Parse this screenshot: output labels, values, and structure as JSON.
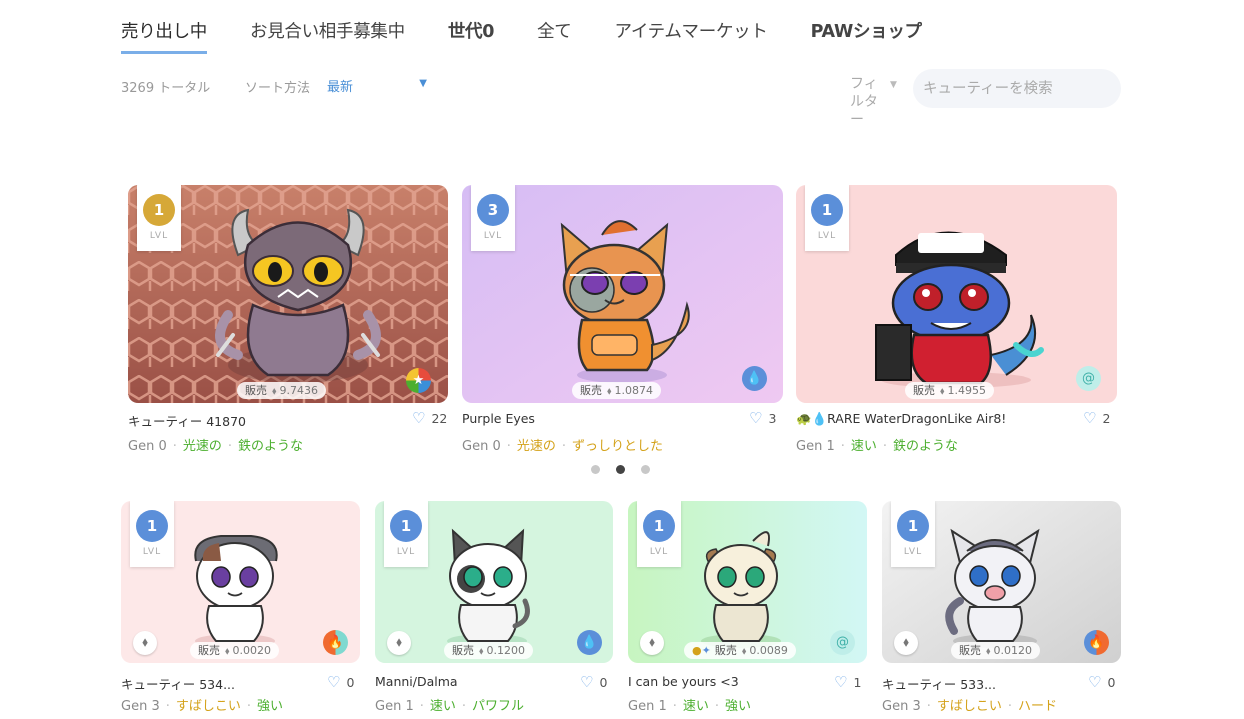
{
  "tabs": [
    {
      "label": "売り出し中",
      "active": true
    },
    {
      "label": "お見合い相手募集中"
    },
    {
      "label": "世代0"
    },
    {
      "label": "全て"
    },
    {
      "label": "アイテムマーケット"
    },
    {
      "label": "PAWショップ"
    }
  ],
  "toolbar": {
    "total": "3269 トータル",
    "sort_label": "ソート方法",
    "sort_value": "最新",
    "filter_label": "フィルター",
    "search_placeholder": "キューティーを検索"
  },
  "featured": [
    {
      "level": "1",
      "level_color": "gold",
      "lvl_label": "LVL",
      "sale": "販売",
      "price": "9.7436",
      "name": "キューティー 41870",
      "likes": "22",
      "gen": "Gen 0",
      "traits": [
        "光速の",
        "鉄のような"
      ],
      "trait_colors": [
        "green",
        "green"
      ],
      "element": "multi"
    },
    {
      "level": "3",
      "level_color": "blue",
      "lvl_label": "LVL",
      "sale": "販売",
      "price": "1.0874",
      "name": "Purple Eyes",
      "likes": "3",
      "gen": "Gen 0",
      "traits": [
        "光速の",
        "ずっしりとした"
      ],
      "trait_colors": [
        "gold",
        "gold"
      ],
      "element": "water"
    },
    {
      "level": "1",
      "level_color": "blue",
      "lvl_label": "LVL",
      "sale": "販売",
      "price": "1.4955",
      "name": "🐢💧RARE WaterDragonLike Air8!",
      "likes": "2",
      "gen": "Gen 1",
      "traits": [
        "速い",
        "鉄のような"
      ],
      "trait_colors": [
        "green",
        "green"
      ],
      "element": "air"
    }
  ],
  "carousel": {
    "pages": 3,
    "active": 1
  },
  "listing": [
    {
      "level": "1",
      "lvl_label": "LVL",
      "sale": "販売",
      "price": "0.0020",
      "name": "キューティー 534...",
      "likes": "0",
      "gen": "Gen 3",
      "traits": [
        "すばしこい",
        "強い"
      ],
      "element": "fire-air"
    },
    {
      "level": "1",
      "lvl_label": "LVL",
      "sale": "販売",
      "price": "0.1200",
      "name": "Manni/Dalma",
      "likes": "0",
      "gen": "Gen 1",
      "traits": [
        "速い",
        "パワフル"
      ],
      "element": "water"
    },
    {
      "level": "1",
      "lvl_label": "LVL",
      "sale": "販売",
      "price": "0.0089",
      "name": "I can be yours <3",
      "likes": "1",
      "gen": "Gen 1",
      "traits": [
        "速い",
        "強い"
      ],
      "element": "air"
    },
    {
      "level": "1",
      "lvl_label": "LVL",
      "sale": "販売",
      "price": "0.0120",
      "name": "キューティー 533...",
      "likes": "0",
      "gen": "Gen 3",
      "traits": [
        "すばしこい",
        "ハード"
      ],
      "element": "water-fire"
    }
  ],
  "colors": {
    "accent": "#7aaee8",
    "trait_green": "#4caf2f",
    "trait_gold": "#d4a21a",
    "level_blue": "#5b8fd9",
    "level_gold": "#d6a838"
  },
  "icons": {
    "eth": "ethereum-icon",
    "heart": "heart-icon",
    "water": "water-drop-icon",
    "fire": "fire-icon",
    "air": "air-swirl-icon"
  }
}
